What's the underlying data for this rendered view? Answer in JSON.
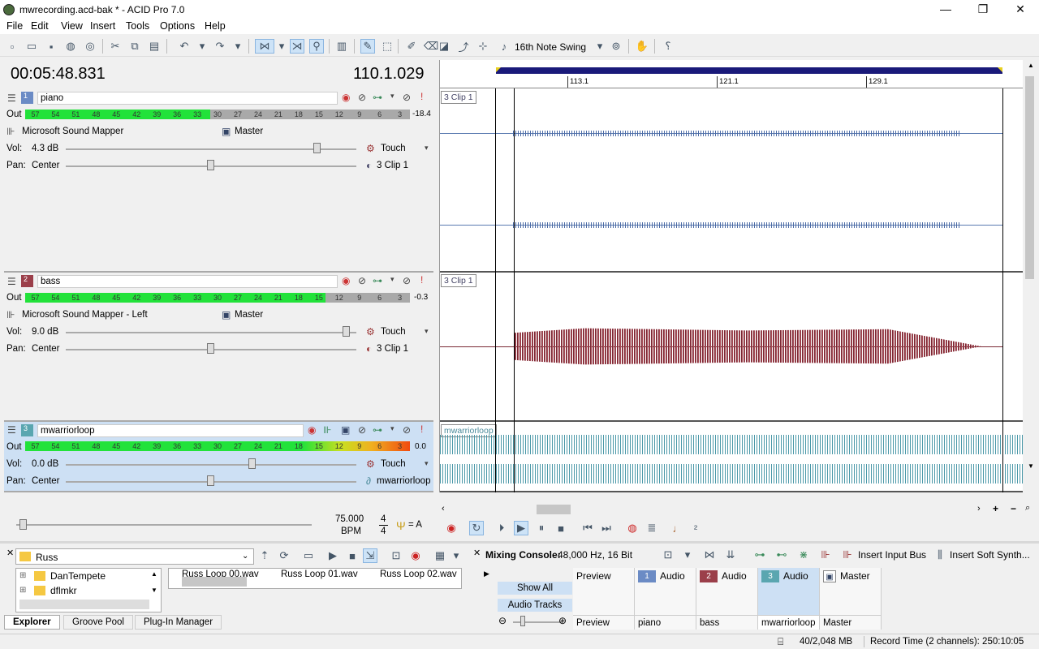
{
  "window": {
    "title": "mwrecording.acd-bak * - ACID Pro 7.0",
    "minimize": "—",
    "restore": "❐",
    "close": "✕"
  },
  "menu": [
    "File",
    "Edit",
    "View",
    "Insert",
    "Tools",
    "Options",
    "Help"
  ],
  "toolbar": {
    "swing_label": "16th Note Swing"
  },
  "transport": {
    "time": "00:05:48.831",
    "measure": "110.1.029"
  },
  "tracks": [
    {
      "num": "1",
      "name": "piano",
      "color": "#6b8bc5",
      "out_label": "Out",
      "meter_scale": [
        "57",
        "54",
        "51",
        "48",
        "45",
        "42",
        "39",
        "36",
        "33",
        "30",
        "27",
        "24",
        "21",
        "18",
        "15",
        "12",
        "9",
        "6",
        "3"
      ],
      "peak": "-18.4",
      "output": "Microsoft Sound Mapper",
      "bus": "Master",
      "vol_label": "Vol:",
      "vol_value": "4.3 dB",
      "vol_level": 0.87,
      "automation": "Touch",
      "pan_label": "Pan:",
      "pan_value": "Center",
      "pan_level": 0.5,
      "clip": "3 Clip 1"
    },
    {
      "num": "2",
      "name": "bass",
      "color": "#9b3f4a",
      "out_label": "Out",
      "meter_scale": [
        "57",
        "54",
        "51",
        "48",
        "45",
        "42",
        "39",
        "36",
        "33",
        "30",
        "27",
        "24",
        "21",
        "18",
        "15",
        "12",
        "9",
        "6",
        "3"
      ],
      "peak": "-0.3",
      "output": "Microsoft Sound Mapper - Left",
      "bus": "Master",
      "vol_label": "Vol:",
      "vol_value": "9.0 dB",
      "vol_level": 0.97,
      "automation": "Touch",
      "pan_label": "Pan:",
      "pan_value": "Center",
      "pan_level": 0.5,
      "clip": "3 Clip 1"
    },
    {
      "num": "3",
      "name": "mwarriorloop",
      "color": "#5aa6b0",
      "out_label": "Out",
      "meter_scale": [
        "57",
        "54",
        "51",
        "48",
        "45",
        "42",
        "39",
        "36",
        "33",
        "30",
        "27",
        "24",
        "21",
        "18",
        "15",
        "12",
        "9",
        "6",
        "3"
      ],
      "peak": "0.0",
      "vol_label": "Vol:",
      "vol_value": "0.0 dB",
      "vol_level": 0.64,
      "automation": "Touch",
      "pan_label": "Pan:",
      "pan_value": "Center",
      "pan_level": 0.5,
      "clip": "mwarriorloop"
    }
  ],
  "tempo": {
    "bpm": "75.000",
    "bpm_label": "BPM",
    "sig_top": "4",
    "sig_bottom": "4",
    "key": "= A"
  },
  "ruler": {
    "marks": [
      "113.1",
      "121.1",
      "129.1"
    ]
  },
  "timeline_clips": [
    "3 Clip 1",
    "3 Clip 1",
    "mwarriorloop"
  ],
  "explorer": {
    "path": "Russ",
    "tree": [
      "DanTempete",
      "dflmkr"
    ],
    "files": [
      "Russ Loop 00.wav",
      "Russ Loop 01.wav",
      "Russ Loop 02.wav"
    ],
    "tabs": [
      "Explorer",
      "Groove Pool",
      "Plug-In Manager"
    ]
  },
  "mixer": {
    "title": "Mixing Console:",
    "format": "48,000 Hz, 16 Bit",
    "insert_bus": "Insert Input Bus",
    "insert_synth": "Insert Soft Synth...",
    "show_all": "Show All",
    "audio_tracks": "Audio Tracks",
    "strips": [
      {
        "badge": "",
        "head": "Preview",
        "foot": "Preview",
        "color": ""
      },
      {
        "badge": "1",
        "head": "Audio",
        "foot": "piano",
        "color": "#6b8bc5"
      },
      {
        "badge": "2",
        "head": "Audio",
        "foot": "bass",
        "color": "#9b3f4a"
      },
      {
        "badge": "3",
        "head": "Audio",
        "foot": "mwarriorloop",
        "color": "#5aa6b0"
      },
      {
        "badge": "",
        "head": "Master",
        "foot": "Master",
        "color": ""
      }
    ]
  },
  "status": {
    "memory": "40/2,048 MB",
    "record_time": "Record Time (2 channels): 250:10:05"
  }
}
